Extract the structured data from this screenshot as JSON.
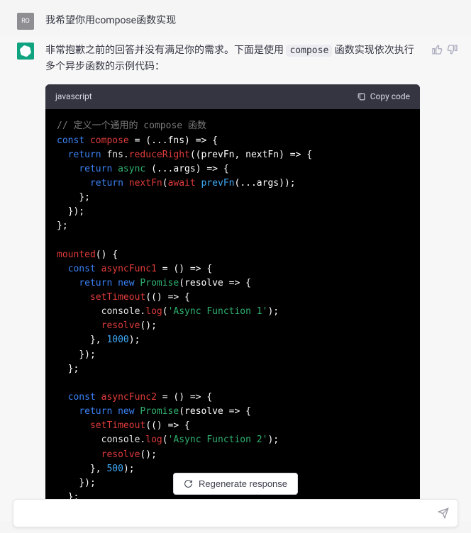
{
  "user": {
    "avatar_label": "RO",
    "message": "我希望你用compose函数实现"
  },
  "assistant": {
    "text_before": "非常抱歉之前的回答并没有满足你的需求。下面是使用 ",
    "inline_code": "compose",
    "text_after": " 函数实现依次执行多个异步函数的示例代码：",
    "code_lang": "javascript",
    "copy_label": "Copy code",
    "code": {
      "comment": "// 定义一个通用的 compose 函数",
      "l1_const": "const",
      "l1_name": "compose",
      "l1_eq": " = (",
      "l1_spread": "...fns",
      "l1_tail": ") => {",
      "l2_return": "return",
      "l2_obj": " fns.",
      "l2_fn": "reduceRight",
      "l2_args_open": "((prevFn, nextFn) ",
      "l2_arrow": "=>",
      "l2_brace": " {",
      "l3_return": "return",
      "l3_async": " async",
      "l3_args": " (",
      "l3_spread": "...args",
      "l3_tail": ") => {",
      "l4_return": "return",
      "l4_fn": " nextFn",
      "l4_open": "(",
      "l4_await": "await",
      "l4_prev": " prevFn",
      "l4_args": "(",
      "l4_spread": "...args",
      "l4_close": "));",
      "l5": "};",
      "l6": "});",
      "l7": "};",
      "l9_mounted": "mounted",
      "l9_tail": "() {",
      "l10_const": "const",
      "l10_name": " asyncFunc1",
      "l10_eq": " = () ",
      "l10_arrow": "=>",
      "l10_brace": " {",
      "l11_return": "return",
      "l11_new": " new",
      "l11_prom": " Promise",
      "l11_args": "(resolve ",
      "l11_arrow": "=>",
      "l11_brace": " {",
      "l12_fn": "setTimeout",
      "l12_args": "(() ",
      "l12_arrow": "=>",
      "l12_brace": " {",
      "l13_obj": "console",
      "l13_dot": ".",
      "l13_log": "log",
      "l13_open": "(",
      "l13_str": "'Async Function 1'",
      "l13_close": ");",
      "l14_fn": "resolve",
      "l14_tail": "();",
      "l15_close": "}, ",
      "l15_num": "1000",
      "l15_tail": ");",
      "l16": "});",
      "l17": "};",
      "l19_const": "const",
      "l19_name": " asyncFunc2",
      "l19_eq": " = () ",
      "l19_arrow": "=>",
      "l19_brace": " {",
      "l20_return": "return",
      "l20_new": " new",
      "l20_prom": " Promise",
      "l20_args": "(resolve ",
      "l20_arrow": "=>",
      "l20_brace": " {",
      "l21_fn": "setTimeout",
      "l21_args": "(() ",
      "l21_arrow": "=>",
      "l21_brace": " {",
      "l22_obj": "console",
      "l22_dot": ".",
      "l22_log": "log",
      "l22_open": "(",
      "l22_str": "'Async Function 2'",
      "l22_close": ");",
      "l23_fn": "resolve",
      "l23_tail": "();",
      "l24_close": "}, ",
      "l24_num": "500",
      "l24_tail": ");",
      "l25": "});",
      "l26": "};"
    }
  },
  "regenerate_label": "Regenerate response",
  "input_placeholder": ""
}
